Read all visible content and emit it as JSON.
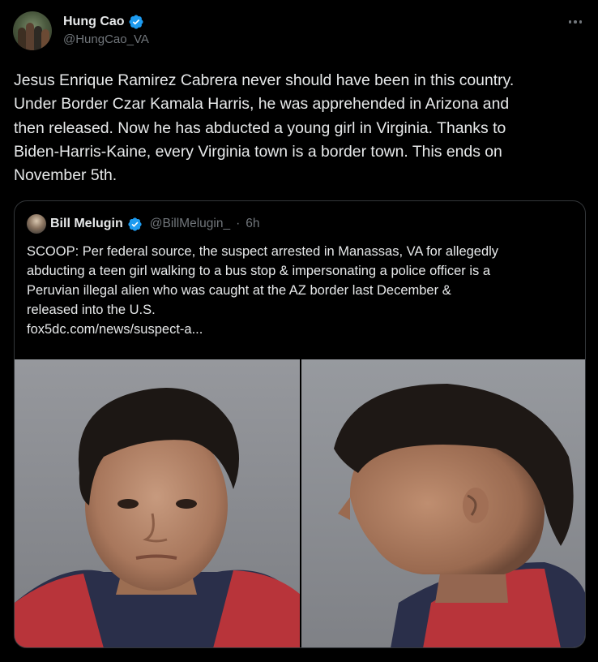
{
  "tweet": {
    "author_name": "Hung Cao",
    "author_handle": "@HungCao_VA",
    "verified_icon": "verified-badge-icon",
    "more_icon": "more-options-icon",
    "text": "Jesus Enrique Ramirez Cabrera never should have been in this country.\nUnder Border Czar Kamala Harris, he was apprehended in Arizona and\nthen released. Now he has abducted a young girl in Virginia. Thanks to\nBiden-Harris-Kaine, every Virginia town is a border town. This ends on\nNovember 5th."
  },
  "quoted_tweet": {
    "author_name": "Bill Melugin",
    "author_handle": "@BillMelugin_",
    "separator": "·",
    "time": "6h",
    "text_lines": [
      "SCOOP: Per federal source, the suspect arrested in Manassas, VA for allegedly",
      "abducting a teen girl walking to a bus stop & impersonating a police officer is a",
      "Peruvian illegal alien who was caught at the AZ border last December &",
      "released into the U.S.",
      "fox5dc.com/news/suspect-a..."
    ]
  },
  "colors": {
    "background": "#000000",
    "text_primary": "#e7e9ea",
    "text_secondary": "#71767b",
    "verified_blue": "#1d9bf0",
    "border": "#333639"
  }
}
